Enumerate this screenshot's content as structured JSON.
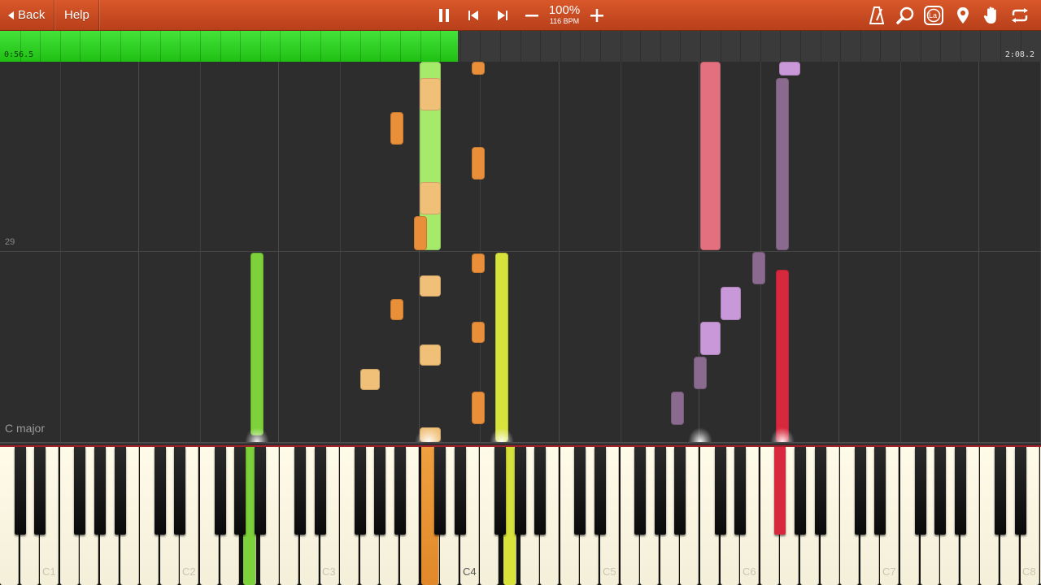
{
  "toolbar": {
    "back_label": "Back",
    "help_label": "Help",
    "speed_percent": "100%",
    "speed_bpm": "116 BPM",
    "icons": [
      "pause-icon",
      "skip-back-icon",
      "skip-forward-icon",
      "minus-icon",
      "plus-icon",
      "metronome-icon",
      "magnifier-icon",
      "label-icon",
      "location-pin-icon",
      "hand-icon",
      "loop-icon"
    ],
    "label_icon_text": "La"
  },
  "progress": {
    "current_time": "0:56.5",
    "total_time": "2:08.2",
    "fraction": 0.44
  },
  "roll": {
    "measure_number": "29",
    "key_signature": "C major"
  },
  "keyboard": {
    "octave_labels": [
      "C1",
      "C2",
      "C3",
      "C4",
      "C5",
      "C6",
      "C7",
      "C8"
    ],
    "colors": {
      "green": "#7dd13a",
      "light_green": "#a5ea6a",
      "orange": "#e98f3a",
      "peach": "#f0c078",
      "yellow": "#d7e23a",
      "pink": "#e2707e",
      "red": "#d8283e",
      "mauve": "#8a6a8e",
      "lilac": "#c898d8"
    }
  }
}
